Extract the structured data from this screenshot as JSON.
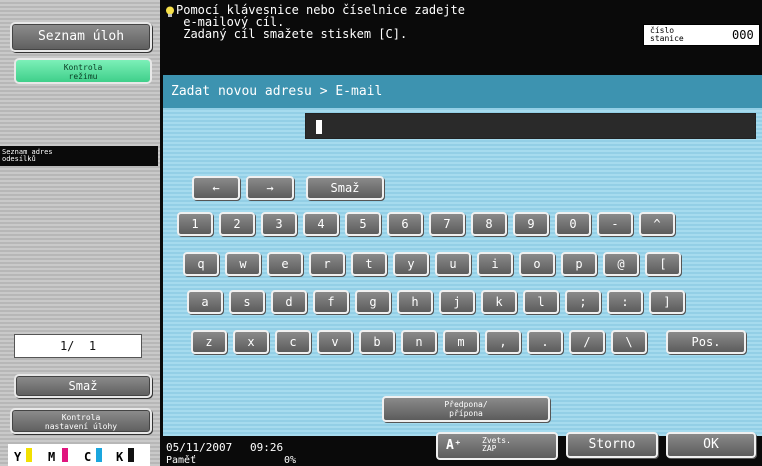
{
  "sidebar": {
    "job_list_label": "Seznam úloh",
    "mode_check_label": "Kontrola\nrežimu",
    "address_list_label": "Seznam adres\nodesílků",
    "page_counter": "1/  1",
    "delete_label": "Smaž",
    "job_settings_label": "Kontrola\nnastavení úlohy",
    "toner": [
      {
        "label": "Y",
        "color": "#f2e000"
      },
      {
        "label": "M",
        "color": "#e0157e"
      },
      {
        "label": "C",
        "color": "#1aa6de"
      },
      {
        "label": "K",
        "color": "#111111"
      }
    ]
  },
  "header": {
    "message": "Pomocí klávesnice nebo číselnice zadejte\n e-mailový cíl.\n Zadaný cíl smažete stiskem [C].",
    "station_label": "číslo\nstanice",
    "station_value": "000"
  },
  "subheader": {
    "title": "Zadat novou adresu > E-mail"
  },
  "address_input": {
    "value": ""
  },
  "keyboard": {
    "arrow_left": "←",
    "arrow_right": "→",
    "delete_label": "Smaž",
    "row1": [
      "1",
      "2",
      "3",
      "4",
      "5",
      "6",
      "7",
      "8",
      "9",
      "0",
      "-",
      "^"
    ],
    "row2": [
      "q",
      "w",
      "e",
      "r",
      "t",
      "y",
      "u",
      "i",
      "o",
      "p",
      "@",
      "["
    ],
    "row3": [
      "a",
      "s",
      "d",
      "f",
      "g",
      "h",
      "j",
      "k",
      "l",
      ";",
      ":",
      "]"
    ],
    "row4": [
      "z",
      "x",
      "c",
      "v",
      "b",
      "n",
      "m",
      ",",
      ".",
      "/",
      "\\"
    ],
    "shift_label": "Pos.",
    "prefix_suffix_label": "Předpona/\npřípona"
  },
  "footer": {
    "date": "05/11/2007",
    "time": "09:26",
    "memory_label": "Paměť",
    "memory_value": "0%",
    "zoom_label": "Zvets.\nZAP",
    "cancel_label": "Storno",
    "ok_label": "OK"
  }
}
